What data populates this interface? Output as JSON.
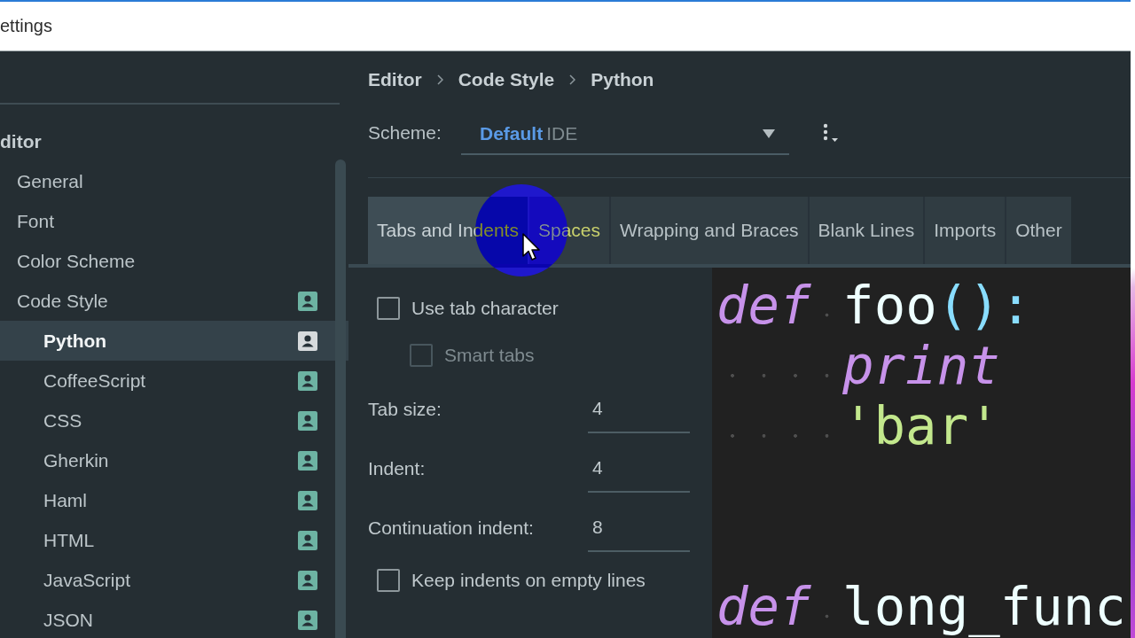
{
  "window": {
    "title": "ettings"
  },
  "sidebar": {
    "tree": [
      {
        "label": "ditor",
        "selected": false,
        "scheme_badge": false,
        "children": [
          {
            "label": "General",
            "selected": false,
            "scheme_badge": false
          },
          {
            "label": "Font",
            "selected": false,
            "scheme_badge": false
          },
          {
            "label": "Color Scheme",
            "selected": false,
            "scheme_badge": false
          },
          {
            "label": "Code Style",
            "selected": false,
            "scheme_badge": true,
            "children": [
              {
                "label": "Python",
                "selected": true,
                "scheme_badge": true
              },
              {
                "label": "CoffeeScript",
                "selected": false,
                "scheme_badge": true
              },
              {
                "label": "CSS",
                "selected": false,
                "scheme_badge": true
              },
              {
                "label": "Gherkin",
                "selected": false,
                "scheme_badge": true
              },
              {
                "label": "Haml",
                "selected": false,
                "scheme_badge": true
              },
              {
                "label": "HTML",
                "selected": false,
                "scheme_badge": true
              },
              {
                "label": "JavaScript",
                "selected": false,
                "scheme_badge": true
              },
              {
                "label": "JSON",
                "selected": false,
                "scheme_badge": true
              }
            ]
          }
        ]
      }
    ]
  },
  "breadcrumb": [
    "Editor",
    "Code Style",
    "Python"
  ],
  "scheme": {
    "label": "Scheme:",
    "value": "Default",
    "scope": "IDE"
  },
  "tabs": [
    {
      "label": "Tabs and Indents",
      "selected": true,
      "hovered": false
    },
    {
      "label": "Spaces",
      "selected": false,
      "hovered": true
    },
    {
      "label": "Wrapping and Braces",
      "selected": false,
      "hovered": false
    },
    {
      "label": "Blank Lines",
      "selected": false,
      "hovered": false
    },
    {
      "label": "Imports",
      "selected": false,
      "hovered": false
    },
    {
      "label": "Other",
      "selected": false,
      "hovered": false
    }
  ],
  "options": [
    {
      "kind": "checkbox",
      "label": "Use tab character",
      "checked": false,
      "disabled": false,
      "children": [
        {
          "kind": "checkbox",
          "label": "Smart tabs",
          "checked": false,
          "disabled": true
        }
      ]
    },
    {
      "kind": "number",
      "label": "Tab size:",
      "value": "4"
    },
    {
      "kind": "number",
      "label": "Indent:",
      "value": "4"
    },
    {
      "kind": "number",
      "label": "Continuation indent:",
      "value": "8"
    },
    {
      "kind": "checkbox",
      "label": "Keep indents on empty lines",
      "checked": false,
      "disabled": false
    }
  ],
  "preview": {
    "lines": [
      {
        "kind": "code",
        "tokens": [
          {
            "kind": "keyword",
            "text": "def "
          },
          {
            "kind": "name",
            "text": "foo"
          },
          {
            "kind": "punct",
            "text": "():"
          }
        ],
        "children": [
          {
            "kind": "code",
            "tokens": [
              {
                "kind": "keyword",
                "text": "print"
              }
            ]
          },
          {
            "kind": "code",
            "tokens": [
              {
                "kind": "string",
                "text": "'bar'"
              }
            ]
          }
        ]
      },
      {
        "kind": "blank"
      },
      {
        "kind": "blank"
      },
      {
        "kind": "code",
        "tokens": [
          {
            "kind": "keyword",
            "text": "def "
          },
          {
            "kind": "name",
            "text": "long_func"
          }
        ]
      }
    ]
  }
}
